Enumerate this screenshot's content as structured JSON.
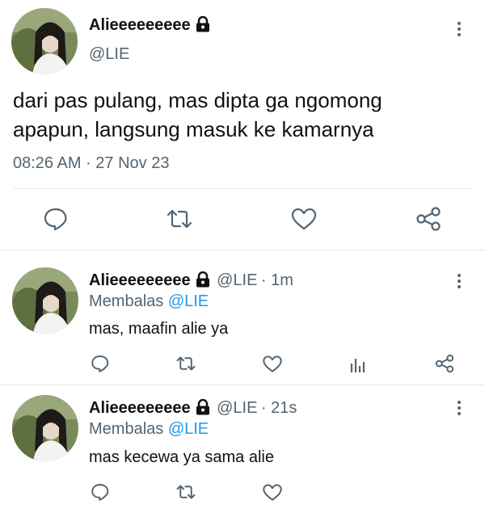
{
  "main_tweet": {
    "display_name": "Alieeeeeeeee",
    "handle": "@LIE",
    "text_line1": "dari pas pulang, mas dipta ga ngomong",
    "text_line2": "apapun, langsung masuk ke kamarnya",
    "timestamp": "08:26 AM · 27 Nov 23"
  },
  "replies": [
    {
      "display_name": "Alieeeeeeeee",
      "handle": "@LIE",
      "time": "· 1m",
      "replying_label": "Membalas",
      "replying_to": "@LIE",
      "text": "mas, maafin alie ya"
    },
    {
      "display_name": "Alieeeeeeeee",
      "handle": "@LIE",
      "time": "· 21s",
      "replying_label": "Membalas",
      "replying_to": "@LIE",
      "text": "mas kecewa ya sama alie"
    }
  ],
  "icons": {
    "reply": "comment-bubble-icon",
    "retweet": "retweet-icon",
    "like": "heart-icon",
    "share": "share-icon",
    "analytics": "analytics-icon",
    "lock": "lock-icon",
    "more": "more-vertical-icon"
  },
  "colors": {
    "accent": "#1d9bf0",
    "muted": "#536471",
    "divider": "#e7e9ea"
  }
}
